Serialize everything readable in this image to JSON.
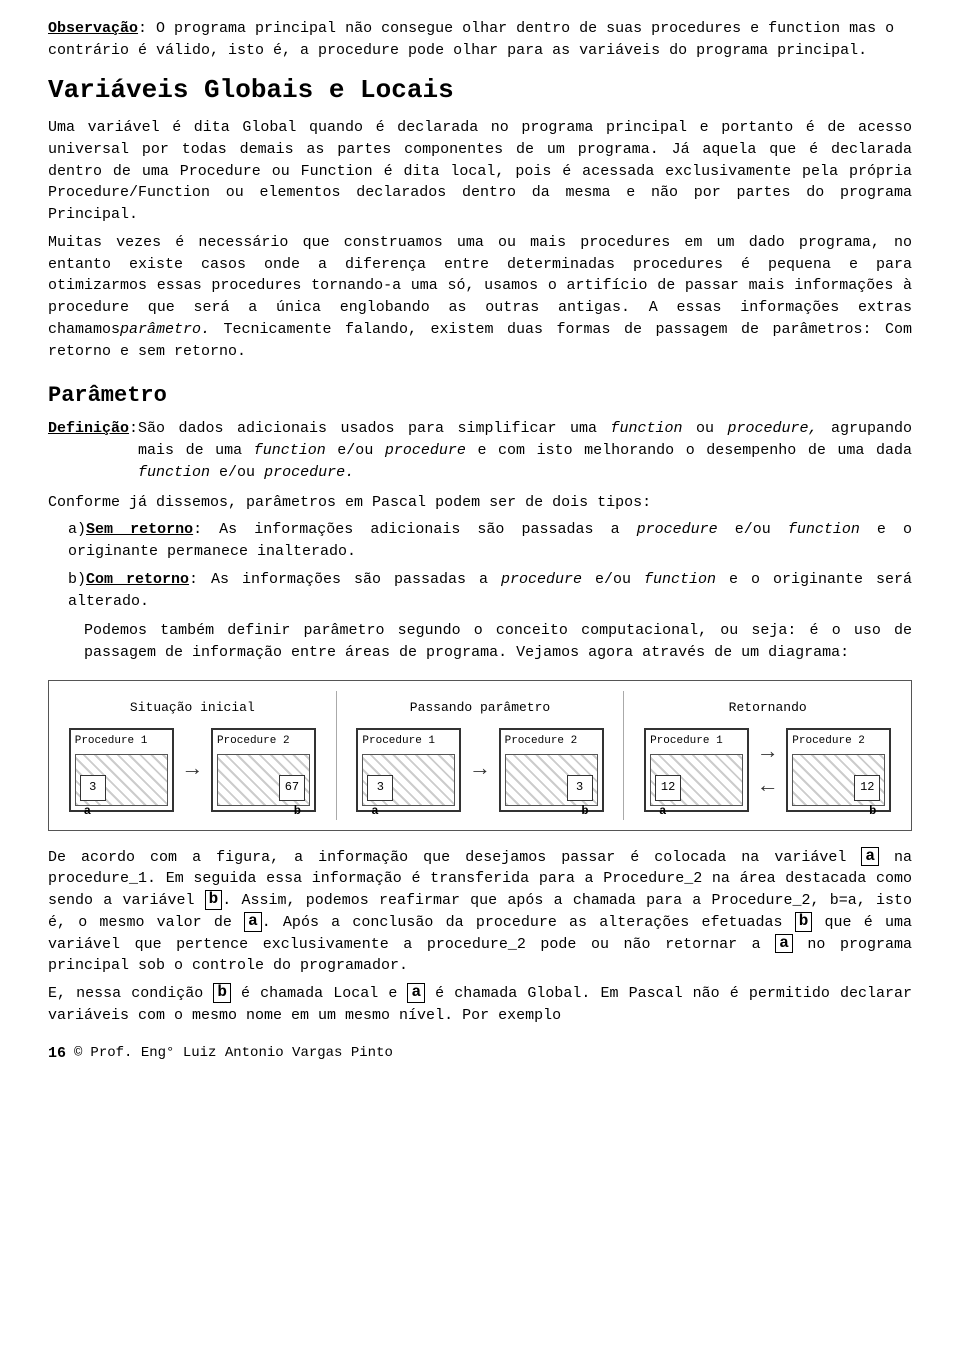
{
  "observation": {
    "label": "Observação",
    "colon": ":",
    "text": " O programa principal não consegue olhar dentro de suas procedures e function mas o contrário é válido, isto é, a procedure pode olhar para as variáveis do programa principal."
  },
  "section_variaveis": {
    "title": "Variáveis Globais e Locais",
    "para1": "Uma variável é dita Global quando é declarada no programa principal e portanto é de acesso universal por todas demais as partes componentes de um programa. Já aquela que é declarada dentro de uma Procedure ou Function é dita local, pois é acessada exclusivamente pela própria Procedure/Function ou elementos declarados dentro da mesma e não por partes do programa Principal.",
    "para2": "Muitas vezes é necessário que construamos uma ou mais procedures em um dado programa, no entanto existe casos onde a diferença entre determinadas procedures é pequena e para otimizarmos essas procedures tornando-a uma só, usamos o artifício de passar mais informações à procedure que será a única englobando as outras antigas. A essas informações extras chamamos",
    "para2_italic": "parâmetro.",
    "para2_end": " Tecnicamente falando, existem duas formas de passagem de parâmetros: Com retorno e sem retorno."
  },
  "section_parametro": {
    "title": "Parâmetro",
    "def_label": "Definição",
    "def_colon": ":",
    "def_text_1": "São dados adicionais usados para simplificar uma ",
    "def_italic1": "function",
    "def_text_2": " ou ",
    "def_italic2": "procedure,",
    "def_text_3": " agrupando mais de uma ",
    "def_italic3": "function",
    "def_text_4": " e/ou ",
    "def_italic4": "procedure",
    "def_text_5": " e com isto melhorando o desempenho de uma dada ",
    "def_italic5": "function",
    "def_text_6": " e/ou ",
    "def_italic6": "procedure.",
    "conforme": "Conforme já dissemos, parâmetros em Pascal podem ser de dois tipos:",
    "sem_retorno_label": "Sem retorno",
    "sem_retorno_text_1": ": As informações adicionais são passadas a ",
    "sem_retorno_italic1": "procedure",
    "sem_retorno_text_2": " e/ou ",
    "sem_retorno_italic2": "function",
    "sem_retorno_text_3": " e o originante permanece inalterado.",
    "com_retorno_label": "Com retorno",
    "com_retorno_text_1": ": As informações são passadas a ",
    "com_retorno_italic1": "procedure",
    "com_retorno_text_2": " e/ou ",
    "com_retorno_italic2": "function",
    "com_retorno_text_3": " e o originante será alterado.",
    "podemos": "Podemos também definir parâmetro segundo o conceito computacional, ou seja: é o uso de passagem de informação entre áreas de programa. Vejamos agora através de um diagrama:"
  },
  "diagram": {
    "sections": [
      {
        "title": "Situação inicial",
        "proc1_label": "Procedure 1",
        "proc1_left_val": "3",
        "proc1_left_var": "a",
        "proc2_label": "Procedure 2",
        "proc2_right_val": "67",
        "proc2_right_var": "b",
        "arrow": "→"
      },
      {
        "title": "Passando parâmetro",
        "proc1_label": "Procedure 1",
        "proc1_left_val": "3",
        "proc1_left_var": "a",
        "proc2_label": "Procedure 2",
        "proc2_right_val": "3",
        "proc2_right_var": "b",
        "arrow": "→"
      },
      {
        "title": "Retornando",
        "proc1_label": "Procedure 1",
        "proc1_left_val": "12",
        "proc1_left_var": "a",
        "proc2_label": "Procedure 2",
        "proc2_right_val": "12",
        "proc2_right_var": "b",
        "arrow": "←"
      }
    ]
  },
  "after_diagram": {
    "para1_1": "De acordo com a figura, a informação que desejamos passar é colocada na variável ",
    "para1_bold1": "a",
    "para1_2": " na procedure_1. Em seguida essa informação é transferida para a Procedure_2 na área destacada como sendo a variável ",
    "para1_bold2": "b",
    "para1_3": ". Assim, podemos reafirmar que após a chamada para a Procedure_2, b=a, isto é, o mesmo valor de ",
    "para1_bold3": "a",
    "para1_4": ". Após a conclusão da procedure as alterações efetuadas ",
    "para1_bold4": "b",
    "para1_5": " que é uma variável que pertence exclusivamente a procedure_2 pode ou não retornar a ",
    "para1_bold5": "a",
    "para1_6": " no programa principal sob o controle do programador.",
    "para2_1": "E, nessa condição ",
    "para2_bold1": "b",
    "para2_2": " é chamada Local e ",
    "para2_bold2": "a",
    "para2_3": " é chamada Global.  Em Pascal não é permitido declarar variáveis com o mesmo nome em um mesmo nível. Por exemplo"
  },
  "footer": {
    "page": "16",
    "copyright": "©",
    "text": " Prof. Eng° Luiz Antonio Vargas Pinto"
  }
}
